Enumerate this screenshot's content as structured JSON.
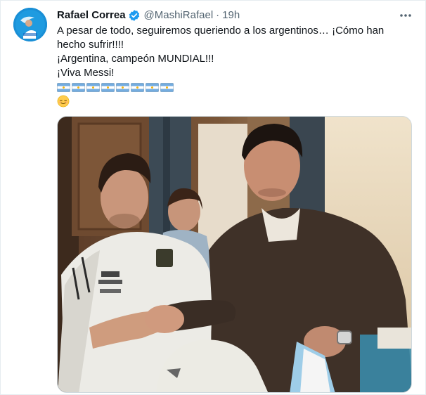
{
  "tweet": {
    "author_name": "Rafael Correa",
    "handle": "@MashiRafael",
    "separator": "·",
    "time": "19h",
    "text_lines": [
      "A pesar de todo, seguiremos queriendo a los argentinos… ¡Cómo han hecho sufrir!!!!",
      "¡Argentina, campeón MUNDIAL!!!",
      "¡Viva Messi!"
    ],
    "flag_count": 8,
    "flag_icon": "argentina-flag-emoji",
    "trailing_emoji": "relieved-face-emoji",
    "more_icon": "more-options-icon",
    "verified_icon": "verified-badge-icon"
  },
  "colors": {
    "text": "#0f1419",
    "secondary_text": "#536471",
    "verified": "#1d9bf0",
    "border": "#cfd9de"
  }
}
